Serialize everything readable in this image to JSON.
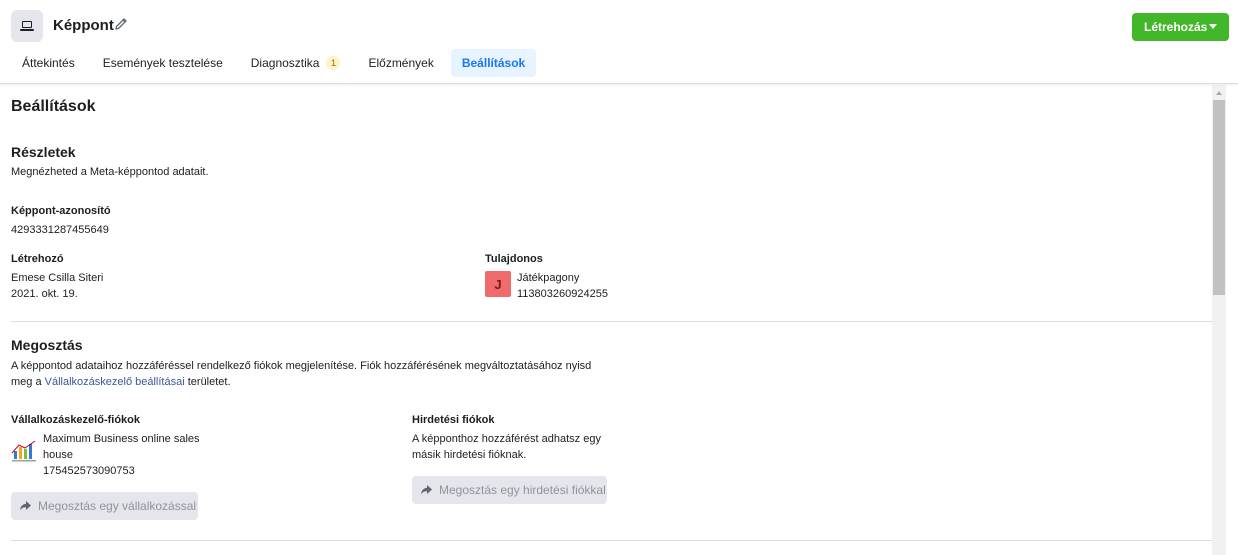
{
  "header": {
    "title": "Képpont",
    "create_label": "Létrehozás",
    "accent": "#42b72a"
  },
  "tabs": [
    {
      "label": "Áttekintés",
      "active": false
    },
    {
      "label": "Események tesztelése",
      "active": false
    },
    {
      "label": "Diagnosztika",
      "badge": "1",
      "active": false
    },
    {
      "label": "Előzmények",
      "active": false
    },
    {
      "label": "Beállítások",
      "active": true
    }
  ],
  "page": {
    "title": "Beállítások"
  },
  "details": {
    "title": "Részletek",
    "description": "Megnézheted a Meta-képpontod adatait.",
    "pixel_id_label": "Képpont-azonosító",
    "pixel_id": "4293331287455649",
    "creator_label": "Létrehozó",
    "creator_name": "Emese Csilla Siteri",
    "created_date": "2021. okt. 19.",
    "owner_label": "Tulajdonos",
    "owner_initial": "J",
    "owner_name": "Játékpagony",
    "owner_id": "113803260924255"
  },
  "sharing": {
    "title": "Megosztás",
    "desc_line1": "A képpontod adataihoz hozzáféréssel rendelkező fiókok megjelenítése. Fiók hozzáférésének megváltoztatásához nyisd",
    "desc_prefix": "meg a ",
    "desc_link": "Vállalkozáskezelő beállításai",
    "desc_suffix": " területet.",
    "business_label": "Vállalkozáskezelő-fiókok",
    "business_name_line1": "Maximum Business online sales",
    "business_name_line2": "house",
    "business_id": "175452573090753",
    "share_business_label": "Megosztás egy vállalkozással",
    "ad_accounts_label": "Hirdetési fiókok",
    "ad_accounts_desc_line1": "A képponthoz hozzáférést adhatsz egy",
    "ad_accounts_desc_line2": "másik hirdetési fióknak.",
    "share_ad_label": "Megosztás egy hirdetési fiókkal"
  }
}
